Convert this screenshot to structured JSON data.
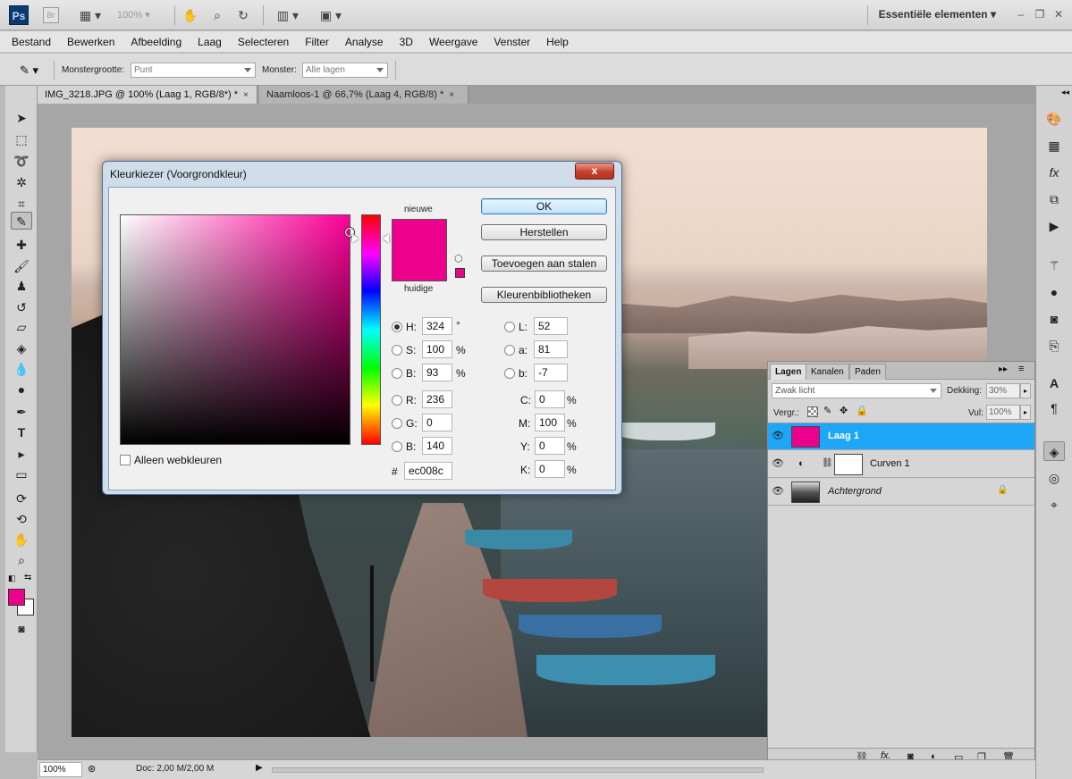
{
  "appbar": {
    "logo": "Ps",
    "bridge": "Br",
    "zoom": "100%",
    "workspace": "Essentiële elementen"
  },
  "menu": [
    "Bestand",
    "Bewerken",
    "Afbeelding",
    "Laag",
    "Selecteren",
    "Filter",
    "Analyse",
    "3D",
    "Weergave",
    "Venster",
    "Help"
  ],
  "options": {
    "sample_size_label": "Monstergrootte:",
    "sample_size_value": "Punt",
    "sample_label": "Monster:",
    "sample_value": "Alle lagen"
  },
  "tabs": [
    {
      "label": "IMG_3218.JPG @ 100% (Laag 1, RGB/8*) *",
      "close": "×"
    },
    {
      "label": "Naamloos-1 @ 66,7% (Laag 4, RGB/8) *",
      "close": "×"
    }
  ],
  "picker": {
    "title": "Kleurkiezer (Voorgrondkleur)",
    "close": "x",
    "new_label": "nieuwe",
    "current_label": "huidige",
    "new_color": "#ec008c",
    "current_color": "#ec008c",
    "buttons": {
      "ok": "OK",
      "reset": "Herstellen",
      "add": "Toevoegen aan stalen",
      "libraries": "Kleurenbibliotheken"
    },
    "hsb": {
      "h_label": "H:",
      "h": "324",
      "h_unit": "°",
      "s_label": "S:",
      "s": "100",
      "s_unit": "%",
      "b_label": "B:",
      "b": "93",
      "b_unit": "%"
    },
    "rgb": {
      "r_label": "R:",
      "r": "236",
      "g_label": "G:",
      "g": "0",
      "b_label": "B:",
      "b": "140"
    },
    "lab": {
      "l_label": "L:",
      "l": "52",
      "a_label": "a:",
      "a": "81",
      "b_label": "b:",
      "b": "-7"
    },
    "cmyk": {
      "c_label": "C:",
      "c": "0",
      "m_label": "M:",
      "m": "100",
      "y_label": "Y:",
      "y": "0",
      "k_label": "K:",
      "k": "0",
      "unit": "%"
    },
    "hex_label": "#",
    "hex": "ec008c",
    "web_only": "Alleen webkleuren"
  },
  "layers_panel": {
    "tabs": [
      "Lagen",
      "Kanalen",
      "Paden"
    ],
    "blend_mode": "Zwak licht",
    "opacity_label": "Dekking:",
    "opacity": "30%",
    "lock_label": "Vergr.:",
    "fill_label": "Vul:",
    "fill": "100%",
    "layers": [
      {
        "name": "Laag 1",
        "selected": true
      },
      {
        "name": "Curven 1",
        "selected": false
      },
      {
        "name": "Achtergrond",
        "selected": false
      }
    ]
  },
  "status": {
    "zoom": "100%",
    "doc": "Doc: 2,00 M/2,00 M"
  },
  "colors": {
    "foreground": "#ec008c",
    "background": "#ffffff",
    "selection": "#1ea7f6"
  }
}
